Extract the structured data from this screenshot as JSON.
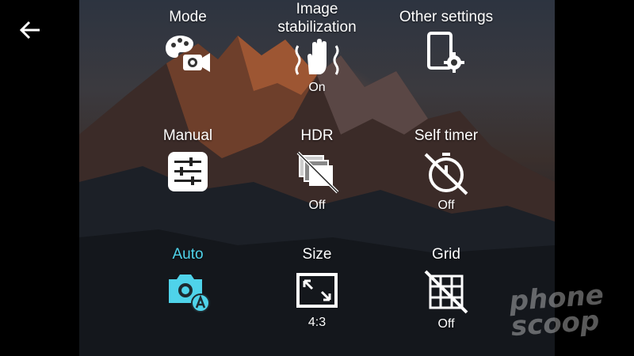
{
  "back": {
    "icon": "arrow-left-icon"
  },
  "settings": [
    {
      "key": "mode",
      "label": "Mode",
      "icon": "palette-video-icon",
      "status": ""
    },
    {
      "key": "image_stabilization",
      "label": "Image stabilization",
      "icon": "hand-shake-icon",
      "status": "On"
    },
    {
      "key": "other_settings",
      "label": "Other settings",
      "icon": "phone-settings-icon",
      "status": ""
    },
    {
      "key": "manual",
      "label": "Manual",
      "icon": "sliders-icon",
      "status": ""
    },
    {
      "key": "hdr",
      "label": "HDR",
      "icon": "hdr-off-icon",
      "status": "Off"
    },
    {
      "key": "self_timer",
      "label": "Self timer",
      "icon": "timer-off-icon",
      "status": "Off"
    },
    {
      "key": "auto",
      "label": "Auto",
      "icon": "camera-auto-icon",
      "status": "",
      "active": true
    },
    {
      "key": "size",
      "label": "Size",
      "icon": "aspect-ratio-icon",
      "status": "4:3"
    },
    {
      "key": "grid",
      "label": "Grid",
      "icon": "grid-off-icon",
      "status": "Off"
    }
  ],
  "watermark": {
    "line1": "phone",
    "line2": "scoop"
  },
  "colors": {
    "active": "#4fd3ea",
    "text": "#ffffff",
    "background": "#000000"
  }
}
